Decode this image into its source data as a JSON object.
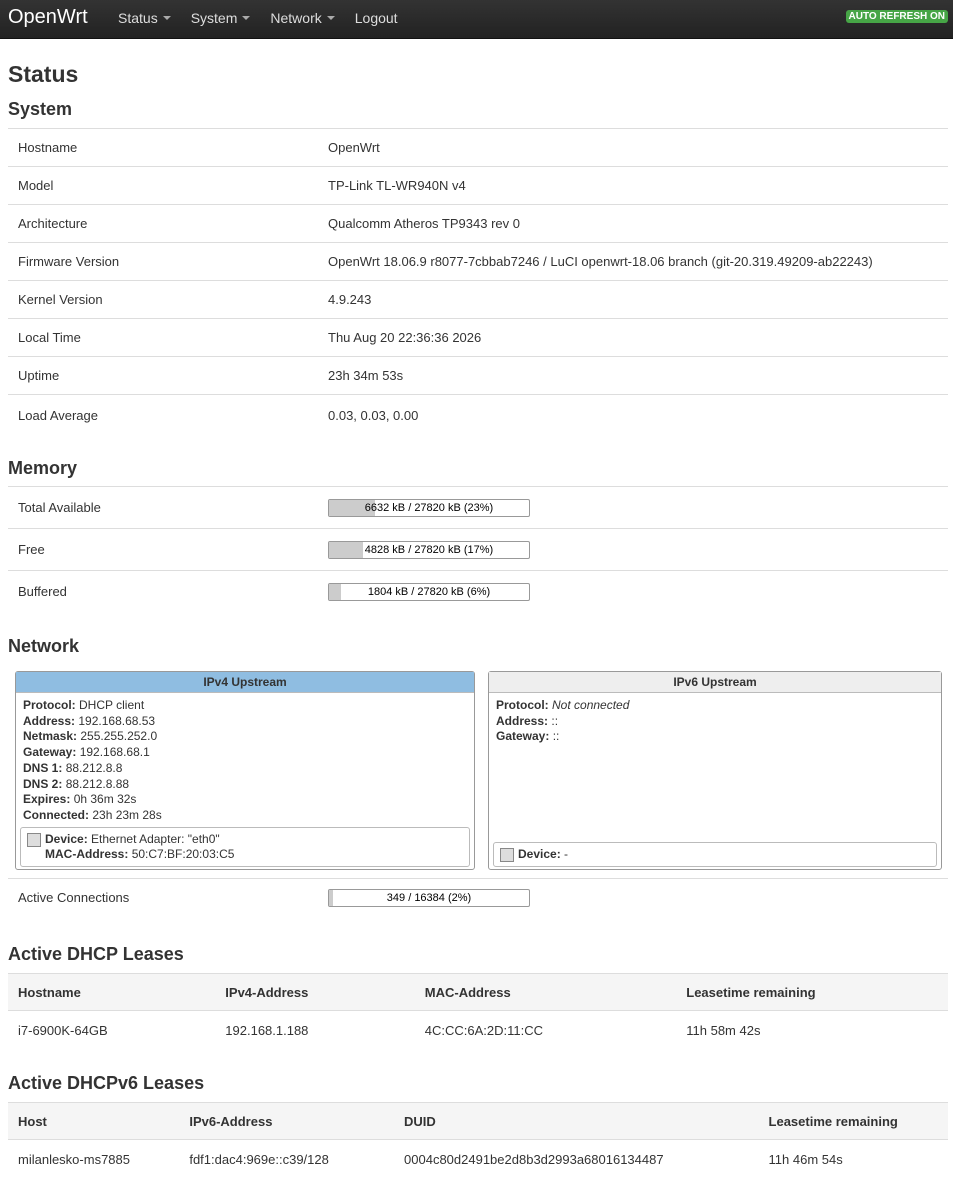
{
  "nav": {
    "brand": "OpenWrt",
    "menu": [
      "Status",
      "System",
      "Network"
    ],
    "logout": "Logout",
    "auto_refresh": "AUTO REFRESH ON"
  },
  "page_title": "Status",
  "system": {
    "title": "System",
    "rows": [
      {
        "k": "Hostname",
        "v": "OpenWrt"
      },
      {
        "k": "Model",
        "v": "TP-Link TL-WR940N v4"
      },
      {
        "k": "Architecture",
        "v": "Qualcomm Atheros TP9343 rev 0"
      },
      {
        "k": "Firmware Version",
        "v": "OpenWrt 18.06.9 r8077-7cbbab7246 / LuCI openwrt-18.06 branch (git-20.319.49209-ab22243)"
      },
      {
        "k": "Kernel Version",
        "v": "4.9.243"
      },
      {
        "k": "Local Time",
        "v": "Thu Aug 20 22:36:36 2026"
      },
      {
        "k": "Uptime",
        "v": "23h 34m 53s"
      },
      {
        "k": "Load Average",
        "v": "0.03, 0.03, 0.00"
      }
    ]
  },
  "memory": {
    "title": "Memory",
    "rows": [
      {
        "k": "Total Available",
        "text": "6632 kB / 27820 kB (23%)",
        "fraction": 0.23
      },
      {
        "k": "Free",
        "text": "4828 kB / 27820 kB (17%)",
        "fraction": 0.17
      },
      {
        "k": "Buffered",
        "text": "1804 kB / 27820 kB (6%)",
        "fraction": 0.06
      }
    ]
  },
  "network": {
    "title": "Network",
    "ipv4": {
      "title": "IPv4 Upstream",
      "lines": [
        {
          "label": "Protocol:",
          "value": "DHCP client"
        },
        {
          "label": "Address:",
          "value": "192.168.68.53"
        },
        {
          "label": "Netmask:",
          "value": "255.255.252.0"
        },
        {
          "label": "Gateway:",
          "value": "192.168.68.1"
        },
        {
          "label": "DNS 1:",
          "value": "88.212.8.8"
        },
        {
          "label": "DNS 2:",
          "value": "88.212.8.88"
        },
        {
          "label": "Expires:",
          "value": "0h 36m 32s"
        },
        {
          "label": "Connected:",
          "value": "23h 23m 28s"
        }
      ],
      "device_label": "Device:",
      "device_value": "Ethernet Adapter: \"eth0\"",
      "mac_label": "MAC-Address:",
      "mac_value": "50:C7:BF:20:03:C5"
    },
    "ipv6": {
      "title": "IPv6 Upstream",
      "lines": [
        {
          "label": "Protocol:",
          "value": "Not connected"
        },
        {
          "label": "Address:",
          "value": "::"
        },
        {
          "label": "Gateway:",
          "value": "::"
        }
      ],
      "device_label": "Device:",
      "device_value": "-"
    },
    "active_connections": {
      "k": "Active Connections",
      "text": "349 / 16384 (2%)",
      "fraction": 0.02
    }
  },
  "dhcp": {
    "title": "Active DHCP Leases",
    "columns": [
      "Hostname",
      "IPv4-Address",
      "MAC-Address",
      "Leasetime remaining"
    ],
    "rows": [
      [
        "i7-6900K-64GB",
        "192.168.1.188",
        "4C:CC:6A:2D:11:CC",
        "11h 58m 42s"
      ]
    ]
  },
  "dhcpv6": {
    "title": "Active DHCPv6 Leases",
    "columns": [
      "Host",
      "IPv6-Address",
      "DUID",
      "Leasetime remaining"
    ],
    "rows": [
      [
        "milanlesko-ms7885",
        "fdf1:dac4:969e::c39/128",
        "0004c80d2491be2d8b3d2993a68016134487",
        "11h 46m 54s"
      ]
    ]
  },
  "colors": {
    "ipv4_header": "#8fbde1",
    "ipv6_header": "#eeeeee",
    "badge": "#46a546",
    "bar_fill": "#cccccc"
  }
}
